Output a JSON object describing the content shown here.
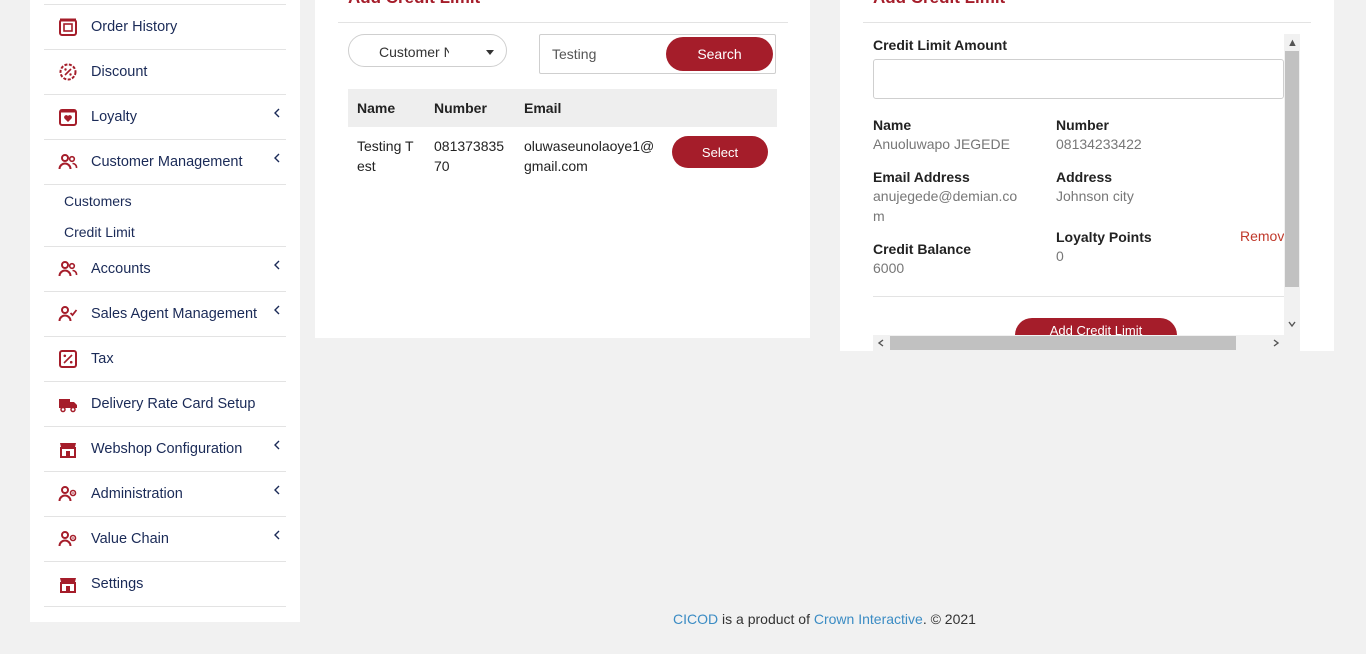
{
  "sidebar": {
    "items": [
      {
        "label": "Order History",
        "icon": "order-history-icon"
      },
      {
        "label": "Discount",
        "icon": "discount-icon"
      },
      {
        "label": "Loyalty",
        "icon": "loyalty-icon",
        "expandable": true
      },
      {
        "label": "Customer Management",
        "icon": "customer-management-icon",
        "expandable": true,
        "children": [
          "Customers",
          "Credit Limit"
        ]
      },
      {
        "label": "Accounts",
        "icon": "accounts-icon",
        "expandable": true
      },
      {
        "label": "Sales Agent Management",
        "icon": "sales-agent-icon",
        "expandable": true
      },
      {
        "label": "Tax",
        "icon": "tax-icon"
      },
      {
        "label": "Delivery Rate Card Setup",
        "icon": "delivery-truck-icon"
      },
      {
        "label": "Webshop Configuration",
        "icon": "webshop-icon",
        "expandable": true
      },
      {
        "label": "Administration",
        "icon": "administration-icon",
        "expandable": true
      },
      {
        "label": "Value Chain",
        "icon": "value-chain-icon",
        "expandable": true
      },
      {
        "label": "Settings",
        "icon": "settings-icon"
      }
    ],
    "sub_customers": "Customers",
    "sub_credit_limit": "Credit Limit"
  },
  "left_panel": {
    "title": "Add Credit Limit",
    "filter_selected": "Customer Name",
    "search_value": "Testing",
    "search_button": "Search",
    "columns": [
      "Name",
      "Number",
      "Email"
    ],
    "rows": [
      {
        "name_line1": "Testing T",
        "name_line2": "est",
        "number_line1": "081373835",
        "number_line2": "70",
        "email_line1": "oluwaseunolaoye1@",
        "email_line2": "gmail.com",
        "action": "Select"
      }
    ]
  },
  "right_panel": {
    "title": "Add Credit Limit",
    "amount_label": "Credit Limit Amount",
    "amount_value": "",
    "name_label": "Name",
    "name_value": "Anuoluwapo JEGEDE",
    "number_label": "Number",
    "number_value": "08134233422",
    "email_label": "Email Address",
    "email_line1": "anujegede@demian.co",
    "email_line2": "m",
    "address_label": "Address",
    "address_value": "Johnson city",
    "credit_balance_label": "Credit Balance",
    "credit_balance_value": "6000",
    "loyalty_label": "Loyalty Points",
    "loyalty_value": "0",
    "remove_label": "Remov",
    "submit_label": "Add Credit Limit"
  },
  "footer": {
    "brand": "CICOD",
    "mid": " is a product of ",
    "company": "Crown Interactive",
    "tail": ". © 2021"
  },
  "colors": {
    "accent": "#a51d2a",
    "link": "#3b8cc4",
    "nav_text": "#1a2a57"
  }
}
